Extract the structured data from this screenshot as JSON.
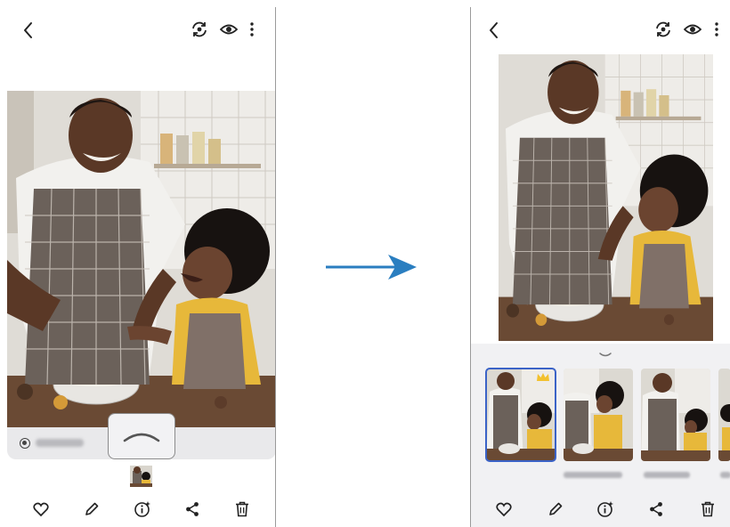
{
  "left_screen": {
    "bottom_bar": {
      "favorite": "heart-icon",
      "edit": "pencil-icon",
      "info": "info-sparkle-icon",
      "share": "share-icon",
      "delete": "trash-icon"
    }
  },
  "right_screen": {
    "thumbnails": [
      {
        "selected": true,
        "badge": "crown-icon"
      },
      {
        "selected": false
      },
      {
        "selected": false
      },
      {
        "selected": false
      }
    ]
  },
  "colors": {
    "selected_outline": "#3b63c7",
    "arrow": "#2a7ec0",
    "crown": "#f2c12e"
  }
}
